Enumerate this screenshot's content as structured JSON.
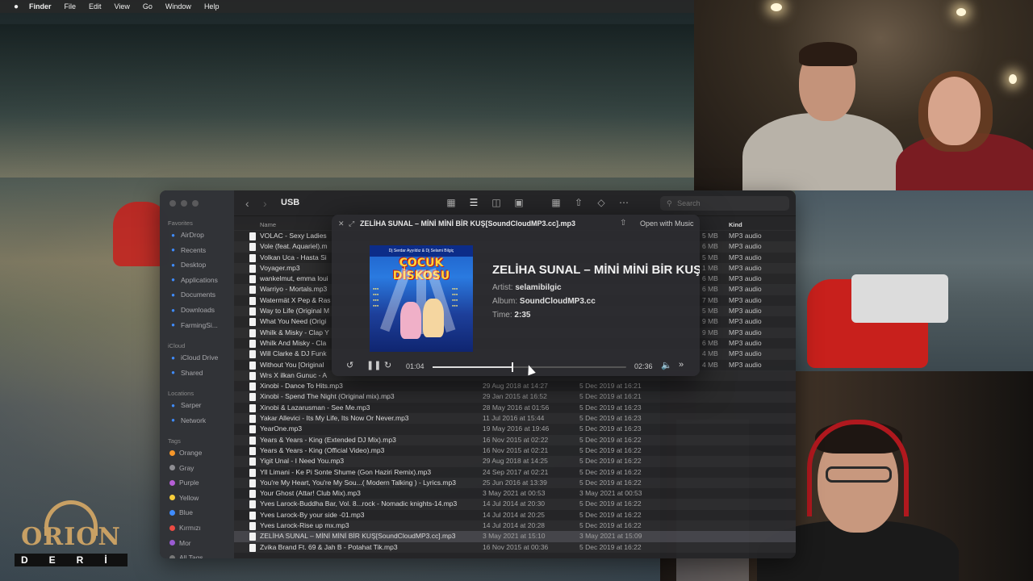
{
  "menubar": {
    "app": "Finder",
    "items": [
      "File",
      "Edit",
      "View",
      "Go",
      "Window",
      "Help"
    ]
  },
  "finder": {
    "title": "USB",
    "search_placeholder": "Search",
    "columns": {
      "name": "Name",
      "kind": "Kind"
    },
    "sidebar": {
      "favorites_label": "Favorites",
      "favorites": [
        {
          "label": "AirDrop",
          "icon": "airdrop-icon"
        },
        {
          "label": "Recents",
          "icon": "clock-icon"
        },
        {
          "label": "Desktop",
          "icon": "desktop-icon"
        },
        {
          "label": "Applications",
          "icon": "applications-icon"
        },
        {
          "label": "Documents",
          "icon": "document-icon"
        },
        {
          "label": "Downloads",
          "icon": "download-icon"
        },
        {
          "label": "FarmingSi...",
          "icon": "folder-icon"
        }
      ],
      "icloud_label": "iCloud",
      "icloud": [
        {
          "label": "iCloud Drive",
          "icon": "cloud-icon"
        },
        {
          "label": "Shared",
          "icon": "shared-folder-icon"
        }
      ],
      "locations_label": "Locations",
      "locations": [
        {
          "label": "Sarper",
          "icon": "laptop-icon"
        },
        {
          "label": "Network",
          "icon": "globe-icon"
        }
      ],
      "tags_label": "Tags",
      "tags": [
        {
          "label": "Orange",
          "color": "#f5962a"
        },
        {
          "label": "Gray",
          "color": "#8e8e93"
        },
        {
          "label": "Purple",
          "color": "#b65fd6"
        },
        {
          "label": "Yellow",
          "color": "#f7cd3b"
        },
        {
          "label": "Blue",
          "color": "#3f8cff"
        },
        {
          "label": "Kırmızı",
          "color": "#ec4b43"
        },
        {
          "label": "Mor",
          "color": "#9a5bd2"
        },
        {
          "label": "All Tags...",
          "color": "#777777"
        }
      ]
    },
    "files": [
      {
        "name": "VOLAC - Sexy Ladies",
        "modified": "",
        "created": "",
        "size": "5 MB",
        "kind": "MP3 audio"
      },
      {
        "name": "Vole (feat. Aquariel).m",
        "modified": "",
        "created": "",
        "size": "6 MB",
        "kind": "MP3 audio"
      },
      {
        "name": "Volkan Uca - Hasta Si",
        "modified": "",
        "created": "",
        "size": "5 MB",
        "kind": "MP3 audio"
      },
      {
        "name": "Voyager.mp3",
        "modified": "",
        "created": "",
        "size": "1 MB",
        "kind": "MP3 audio"
      },
      {
        "name": "wankelmut, emma loui",
        "modified": "",
        "created": "",
        "size": "6 MB",
        "kind": "MP3 audio"
      },
      {
        "name": "Warriyo - Mortals.mp3",
        "modified": "",
        "created": "",
        "size": "6 MB",
        "kind": "MP3 audio"
      },
      {
        "name": "Watermät X Pep & Ras",
        "modified": "",
        "created": "",
        "size": "7 MB",
        "kind": "MP3 audio"
      },
      {
        "name": "Way to Life (Original M",
        "modified": "",
        "created": "",
        "size": "5 MB",
        "kind": "MP3 audio"
      },
      {
        "name": "What You Need (Origi",
        "modified": "",
        "created": "",
        "size": "9 MB",
        "kind": "MP3 audio"
      },
      {
        "name": "Whilk & Misky - Clap Y",
        "modified": "",
        "created": "",
        "size": "9 MB",
        "kind": "MP3 audio"
      },
      {
        "name": "Whilk And Misky - Cla",
        "modified": "",
        "created": "",
        "size": "6 MB",
        "kind": "MP3 audio"
      },
      {
        "name": "Will Clarke & DJ Funk",
        "modified": "",
        "created": "",
        "size": "4 MB",
        "kind": "MP3 audio"
      },
      {
        "name": "Without You [Original",
        "modified": "",
        "created": "",
        "size": "4 MB",
        "kind": "MP3 audio"
      },
      {
        "name": "Wrs X ilkan Gunuc - A",
        "modified": "",
        "created": "",
        "size": "",
        "kind": ""
      },
      {
        "name": "Xinobi - Dance To Hits.mp3",
        "modified": "29 Aug 2018 at 14:27",
        "created": "5 Dec 2019 at 16:21",
        "size": "",
        "kind": ""
      },
      {
        "name": "Xinobi - Spend The Night (Original mix).mp3",
        "modified": "29 Jan 2015 at 16:52",
        "created": "5 Dec 2019 at 16:21",
        "size": "",
        "kind": ""
      },
      {
        "name": "Xinobi & Lazarusman - See Me.mp3",
        "modified": "28 May 2016 at 01:56",
        "created": "5 Dec 2019 at 16:23",
        "size": "",
        "kind": ""
      },
      {
        "name": "Yakar Allevici - Its My Life, Its Now Or Never.mp3",
        "modified": "11 Jul 2016 at 15:44",
        "created": "5 Dec 2019 at 16:23",
        "size": "",
        "kind": ""
      },
      {
        "name": "YearOne.mp3",
        "modified": "19 May 2016 at 19:46",
        "created": "5 Dec 2019 at 16:23",
        "size": "",
        "kind": ""
      },
      {
        "name": "Years & Years - King (Extended DJ Mix).mp3",
        "modified": "16 Nov 2015 at 02:22",
        "created": "5 Dec 2019 at 16:22",
        "size": "",
        "kind": ""
      },
      {
        "name": "Years & Years - King (Official Video).mp3",
        "modified": "16 Nov 2015 at 02:21",
        "created": "5 Dec 2019 at 16:22",
        "size": "",
        "kind": ""
      },
      {
        "name": "Yigit Unal - I Need You.mp3",
        "modified": "29 Aug 2018 at 14:25",
        "created": "5 Dec 2019 at 16:22",
        "size": "",
        "kind": ""
      },
      {
        "name": "Yll Limani - Ke Pi Sonte Shume (Gon Haziri Remix).mp3",
        "modified": "24 Sep 2017 at 02:21",
        "created": "5 Dec 2019 at 16:22",
        "size": "",
        "kind": ""
      },
      {
        "name": "You're My Heart, You're My Sou...( Modern Talking ) - Lyrics.mp3",
        "modified": "25 Jun 2016 at 13:39",
        "created": "5 Dec 2019 at 16:22",
        "size": "",
        "kind": ""
      },
      {
        "name": "Your Ghost (Attar! Club Mix).mp3",
        "modified": "3 May 2021 at 00:53",
        "created": "3 May 2021 at 00:53",
        "size": "",
        "kind": ""
      },
      {
        "name": "Yves Larock-Buddha Bar, Vol. 8...rock - Nomadic knights-14.mp3",
        "modified": "14 Jul 2014 at 20:30",
        "created": "5 Dec 2019 at 16:22",
        "size": "",
        "kind": ""
      },
      {
        "name": "Yves Larock-By your side -01.mp3",
        "modified": "14 Jul 2014 at 20:25",
        "created": "5 Dec 2019 at 16:22",
        "size": "",
        "kind": ""
      },
      {
        "name": "Yves Larock-Rise up mx.mp3",
        "modified": "14 Jul 2014 at 20:28",
        "created": "5 Dec 2019 at 16:22",
        "size": "",
        "kind": ""
      },
      {
        "name": "ZELİHA SUNAL – MİNİ MİNİ BİR KUŞ[SoundCloudMP3.cc].mp3",
        "modified": "3 May 2021 at 15:10",
        "created": "3 May 2021 at 15:09",
        "size": "",
        "kind": "",
        "selected": true
      },
      {
        "name": "Zvika Brand Ft. 69 & Jah B - Potahat Tik.mp3",
        "modified": "16 Nov 2015 at 00:36",
        "created": "5 Dec 2019 at 16:22",
        "size": "",
        "kind": ""
      }
    ]
  },
  "quicklook": {
    "filename": "ZELİHA SUNAL – MİNİ MİNİ BİR KUŞ[SoundCloudMP3.cc].mp3",
    "open_with": "Open with Music",
    "title": "ZELİHA SUNAL – MİNİ MİNİ BİR KUŞ",
    "artist_label": "Artist:",
    "artist": "selamibilgic",
    "album_label": "Album:",
    "album": "SoundCloudMP3.cc",
    "time_label": "Time:",
    "time": "2:35",
    "current_time": "01:04",
    "duration": "02:36",
    "progress": 0.41,
    "cover": {
      "credit": "Dj Serdar Ayyıldız & Dj Selami Bilgiç",
      "title": "ÇOCUK DİSKOSU"
    }
  },
  "logo": {
    "name": "ORION",
    "sub": "DERİ"
  }
}
